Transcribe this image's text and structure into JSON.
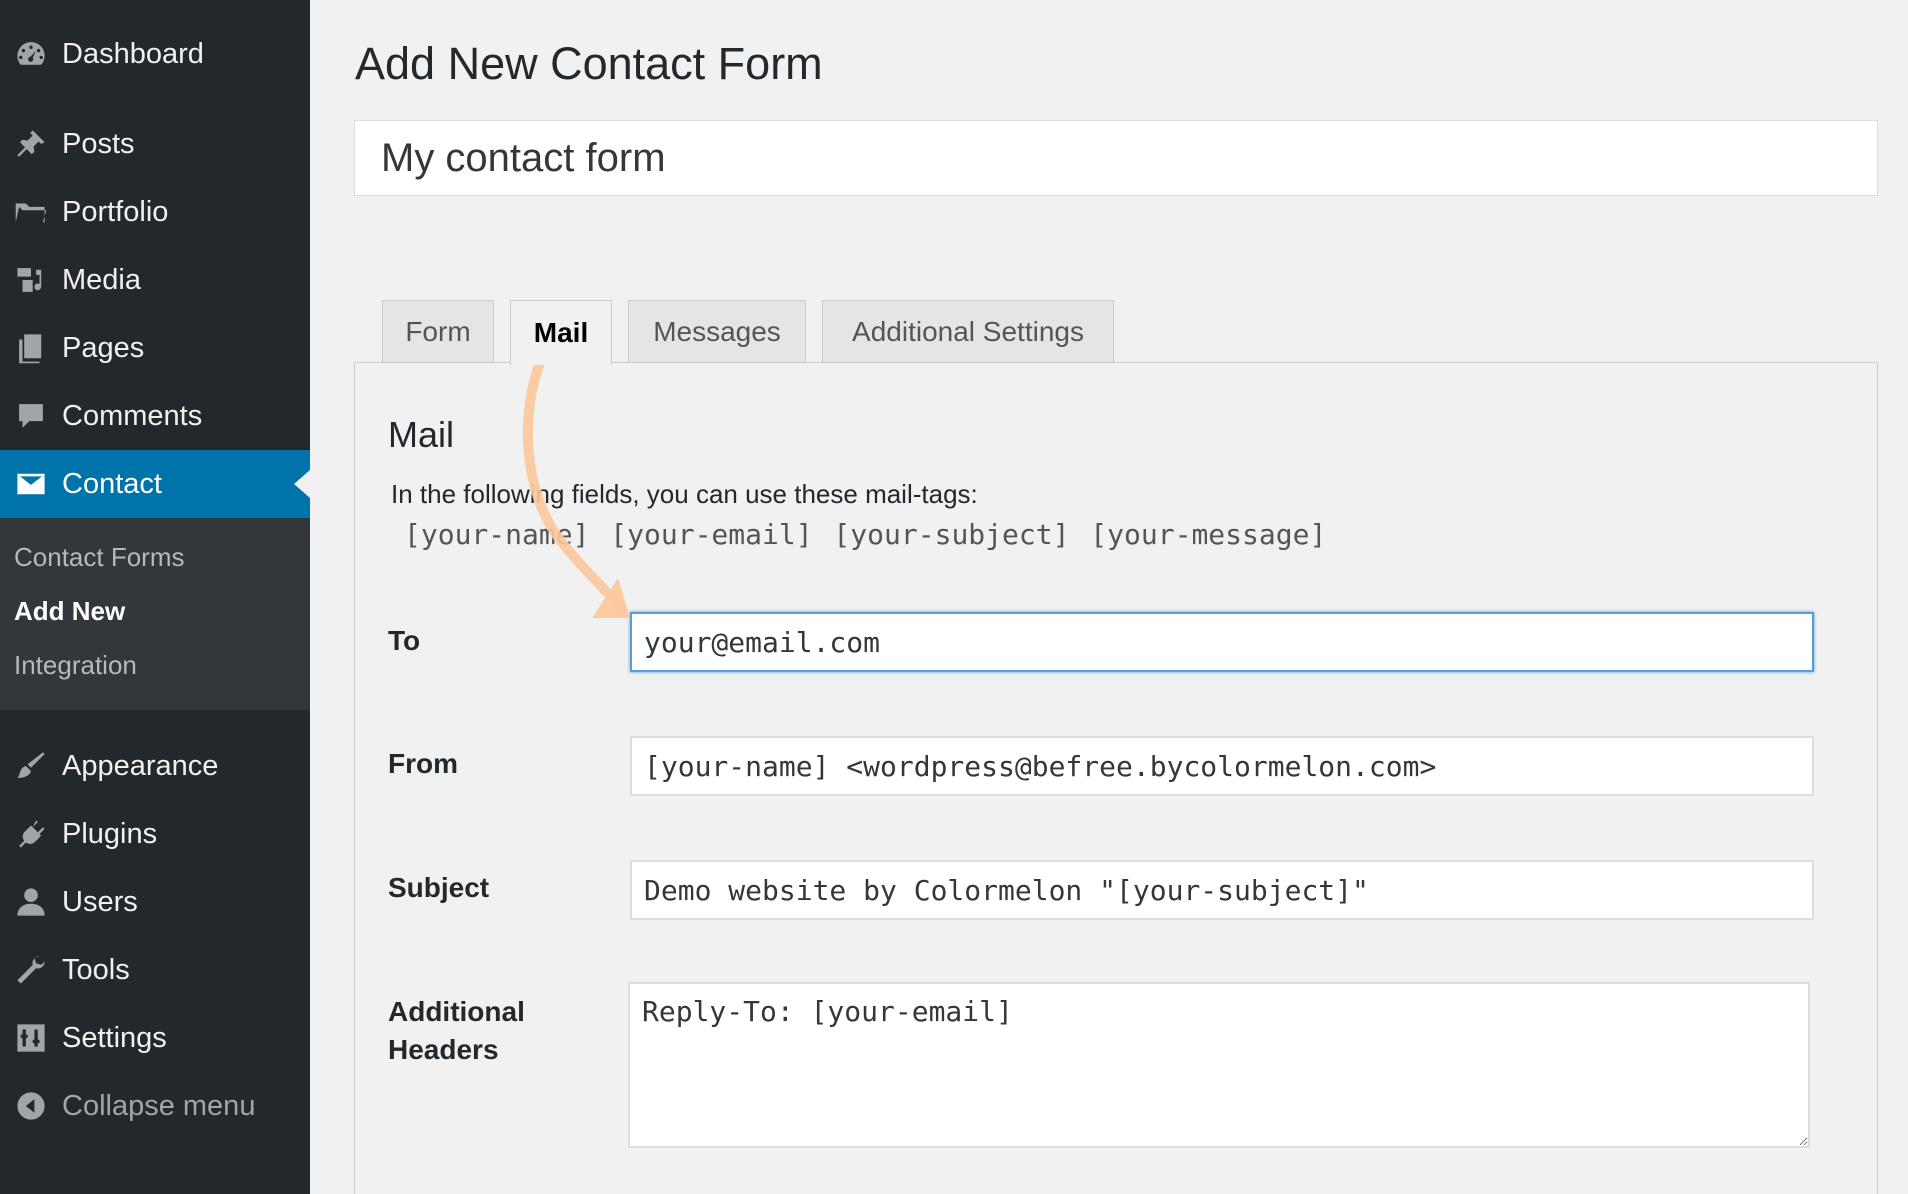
{
  "sidebar": {
    "items": [
      {
        "label": "Dashboard",
        "icon": "dashboard-icon"
      },
      {
        "label": "Posts",
        "icon": "pin-icon"
      },
      {
        "label": "Portfolio",
        "icon": "folder-icon"
      },
      {
        "label": "Media",
        "icon": "media-icon"
      },
      {
        "label": "Pages",
        "icon": "pages-icon"
      },
      {
        "label": "Comments",
        "icon": "comment-icon"
      },
      {
        "label": "Contact",
        "icon": "envelope-icon"
      },
      {
        "label": "Appearance",
        "icon": "brush-icon"
      },
      {
        "label": "Plugins",
        "icon": "plug-icon"
      },
      {
        "label": "Users",
        "icon": "user-icon"
      },
      {
        "label": "Tools",
        "icon": "wrench-icon"
      },
      {
        "label": "Settings",
        "icon": "sliders-icon"
      }
    ],
    "submenu": [
      "Contact Forms",
      "Add New",
      "Integration"
    ],
    "collapse_label": "Collapse menu",
    "active_color": "#0073aa",
    "background_color": "#23282d"
  },
  "page": {
    "title": "Add New Contact Form",
    "form_title_value": "My contact form"
  },
  "tabs": [
    "Form",
    "Mail",
    "Messages",
    "Additional Settings"
  ],
  "mail": {
    "heading": "Mail",
    "help_text": "In the following fields, you can use these mail-tags:",
    "mail_tags": "[your-name] [your-email] [your-subject] [your-message]",
    "to_label": "To",
    "to_value": "your@email.com",
    "from_label": "From",
    "from_value": "[your-name] <wordpress@befree.bycolormelon.com>",
    "subject_label": "Subject",
    "subject_value": "Demo website by Colormelon \"[your-subject]\"",
    "headers_label_line1": "Additional",
    "headers_label_line2": "Headers",
    "headers_value": "Reply-To: [your-email]"
  },
  "annotation": {
    "arrow_color": "#fcc89b"
  }
}
